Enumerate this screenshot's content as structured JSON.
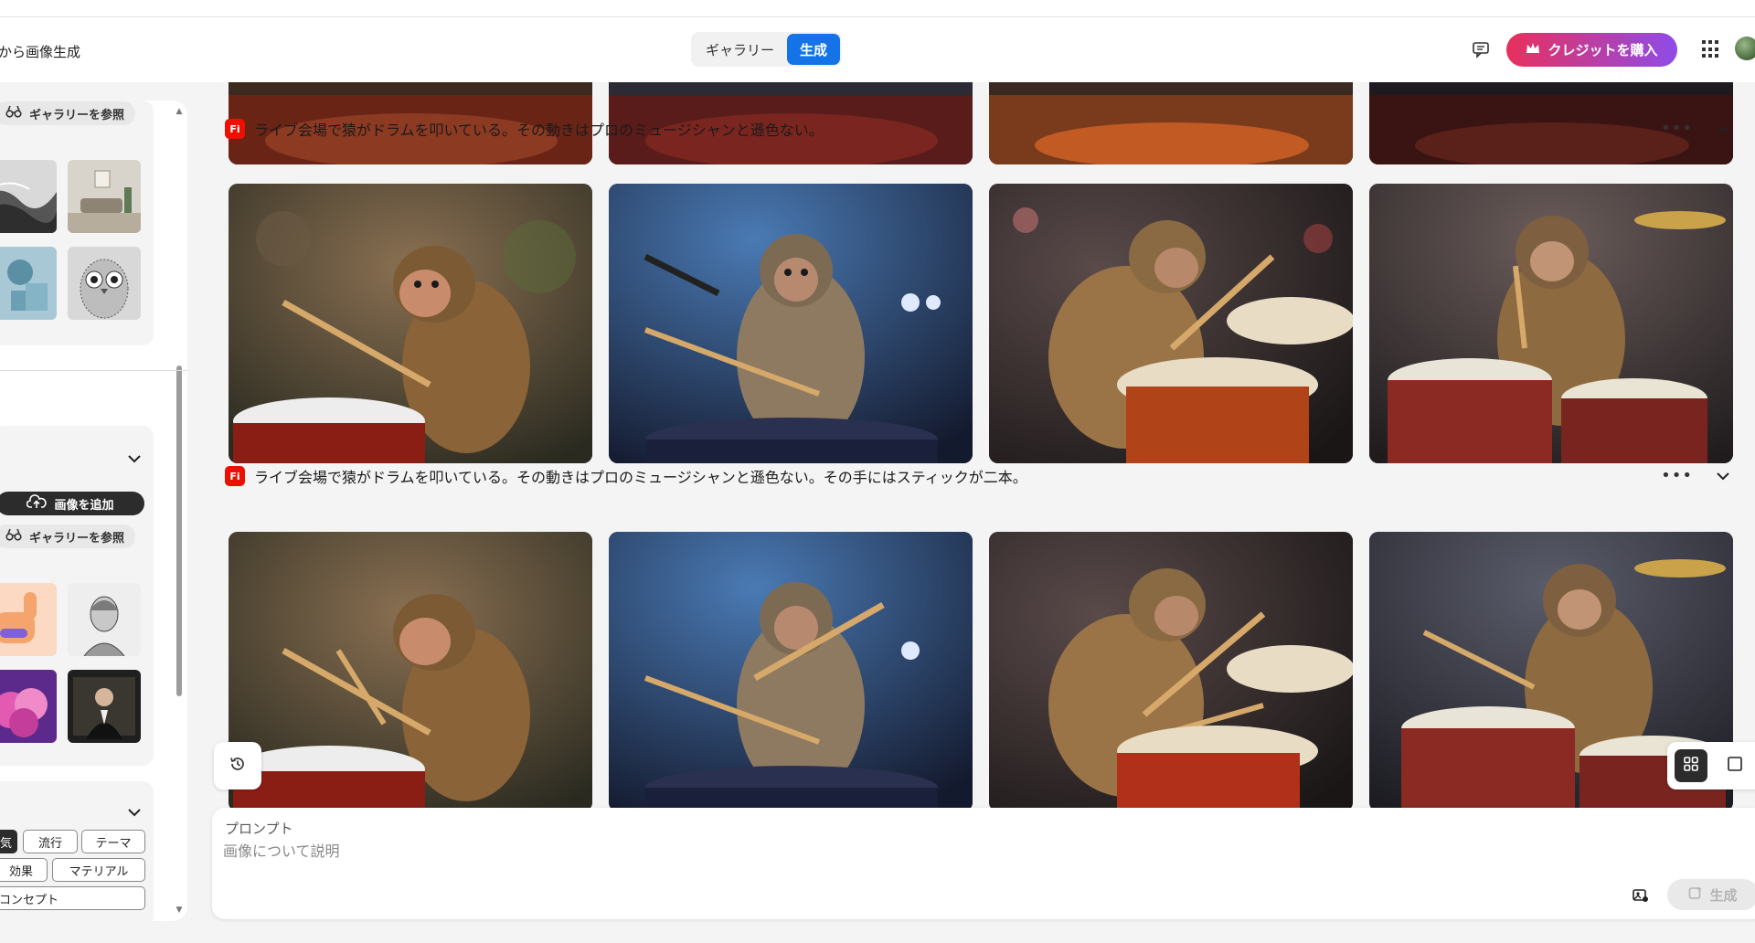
{
  "header": {
    "app_title": "から画像生成",
    "tabs": [
      {
        "label": "ギャラリー",
        "active": false
      },
      {
        "label": "生成",
        "active": true
      }
    ],
    "buy_credits_label": "クレジットを購入",
    "icons": [
      "chat-icon",
      "crown-icon",
      "apps-grid-icon",
      "user-avatar"
    ],
    "brand_gradient": [
      "#e8305c",
      "#8e4ce8"
    ],
    "accent": "#1473e6"
  },
  "sidebar": {
    "reference_section": {
      "browse_gallery_label": "ギャラリーを参照"
    },
    "style_section": {
      "add_image_label": "画像を追加",
      "browse_gallery_label": "ギャラリーを参照"
    },
    "effects_section": {
      "tags": [
        "気",
        "流行",
        "テーマ",
        "効果",
        "マテリアル",
        "コンセプト"
      ]
    }
  },
  "main": {
    "rows": [
      {
        "title": ""
      },
      {
        "title": "ライブ会場で猿がドラムを叩いている。その動きはプロのミュージシャンと遜色ない。"
      },
      {
        "title": "ライブ会場で猿がドラムを叩いている。その動きはプロのミュージシャンと遜色ない。その手にはスティックが二本。"
      }
    ],
    "badge_label": "Fi",
    "badge_color": "#eb1000"
  },
  "prompt": {
    "label": "プロンプト",
    "placeholder": "画像について説明",
    "generate_label": "生成"
  }
}
